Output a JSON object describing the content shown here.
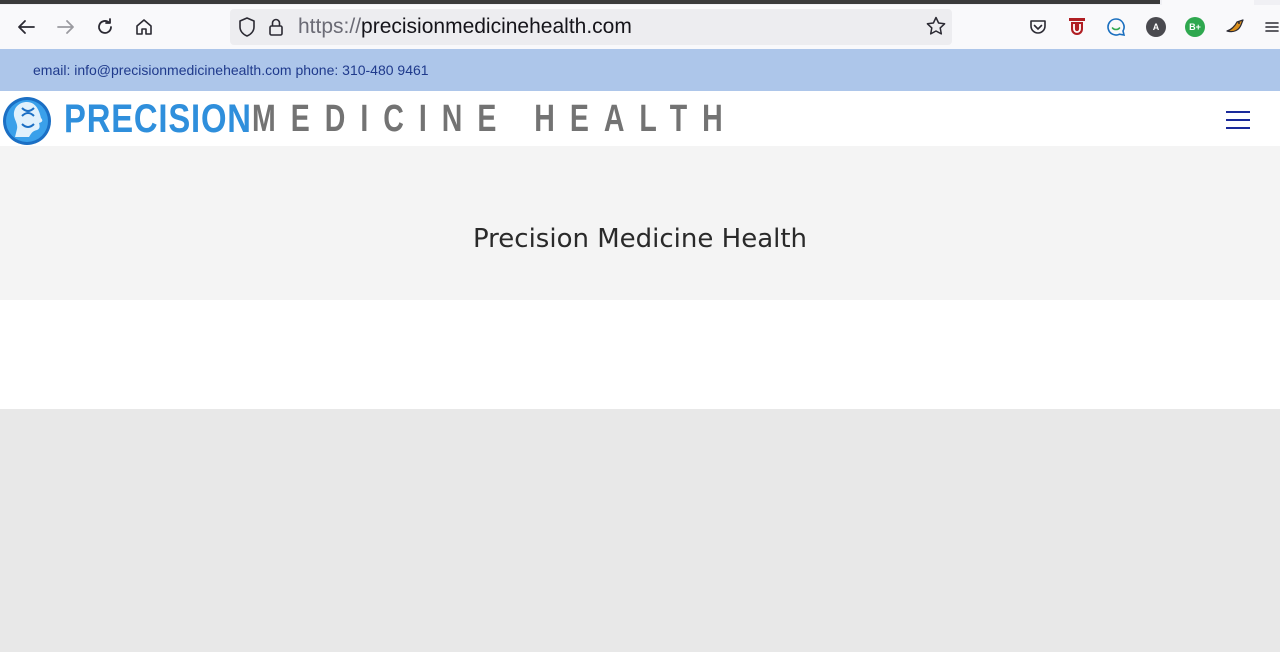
{
  "browser": {
    "url_scheme": "https://",
    "url_host": "precisionmedicinehealth.com",
    "extensions": [
      {
        "name": "pocket-icon"
      },
      {
        "name": "ublock-icon"
      },
      {
        "name": "chat-extension-icon"
      },
      {
        "name": "account-a-icon",
        "label": "A",
        "color": "#4a4a4f"
      },
      {
        "name": "bplus-extension-icon",
        "label": "B+",
        "color": "#2fa84f"
      },
      {
        "name": "extension-bird-icon"
      }
    ]
  },
  "site": {
    "contact_line": "email: info@precisionmedicinehealth.com phone: 310-480 9461",
    "logo_word1": "PRECISION",
    "logo_word2": "MEDICINE HEALTH",
    "page_title": "Precision Medicine Health",
    "colors": {
      "topbar": "#adc6ea",
      "contact_text": "#1f3a8c",
      "logo_blue": "#2f8fdc",
      "logo_gray": "#737373",
      "menu": "#1a2a9a"
    }
  }
}
